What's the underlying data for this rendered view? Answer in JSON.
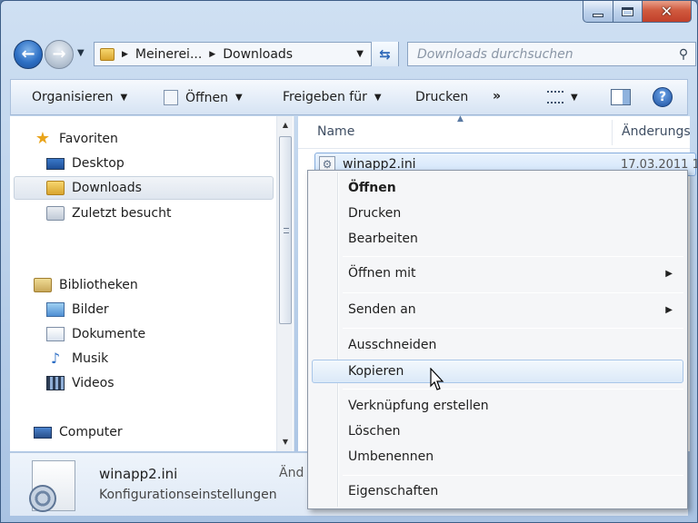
{
  "window": {
    "caption_buttons": {
      "minimize": "minimize-icon",
      "maximize": "maximize-icon",
      "close": "close-icon"
    }
  },
  "nav": {
    "address": {
      "crumbs": [
        "Meinerei...",
        "Downloads"
      ]
    },
    "search": {
      "placeholder": "Downloads durchsuchen"
    }
  },
  "toolbar": {
    "organize": "Organisieren",
    "open": "Öffnen",
    "share": "Freigeben für",
    "print": "Drucken",
    "more": "»"
  },
  "navpane": {
    "items": [
      {
        "label": "Favoriten",
        "icon": "star-icon"
      },
      {
        "label": "Desktop",
        "icon": "desktop-icon"
      },
      {
        "label": "Downloads",
        "icon": "downloads-folder-icon",
        "selected": true
      },
      {
        "label": "Zuletzt besucht",
        "icon": "recent-places-icon"
      },
      {
        "label": "Bibliotheken",
        "icon": "libraries-icon"
      },
      {
        "label": "Bilder",
        "icon": "pictures-icon"
      },
      {
        "label": "Dokumente",
        "icon": "documents-icon"
      },
      {
        "label": "Musik",
        "icon": "music-icon"
      },
      {
        "label": "Videos",
        "icon": "videos-icon"
      },
      {
        "label": "Computer",
        "icon": "computer-icon"
      }
    ]
  },
  "filelist": {
    "columns": {
      "name": "Name",
      "changed": "Änderungs"
    },
    "rows": [
      {
        "name": "winapp2.ini",
        "date": "17.03.2011 1"
      }
    ]
  },
  "details": {
    "name": "winapp2.ini",
    "type": "Konfigurationseinstellungen",
    "partial_label": "Änd"
  },
  "context_menu": {
    "items": {
      "open": "Öffnen",
      "print": "Drucken",
      "edit": "Bearbeiten",
      "open_with": "Öffnen mit",
      "send_to": "Senden an",
      "cut": "Ausschneiden",
      "copy": "Kopieren",
      "create_shortcut": "Verknüpfung erstellen",
      "delete": "Löschen",
      "rename": "Umbenennen",
      "properties": "Eigenschaften"
    },
    "hovered": "Kopieren"
  }
}
